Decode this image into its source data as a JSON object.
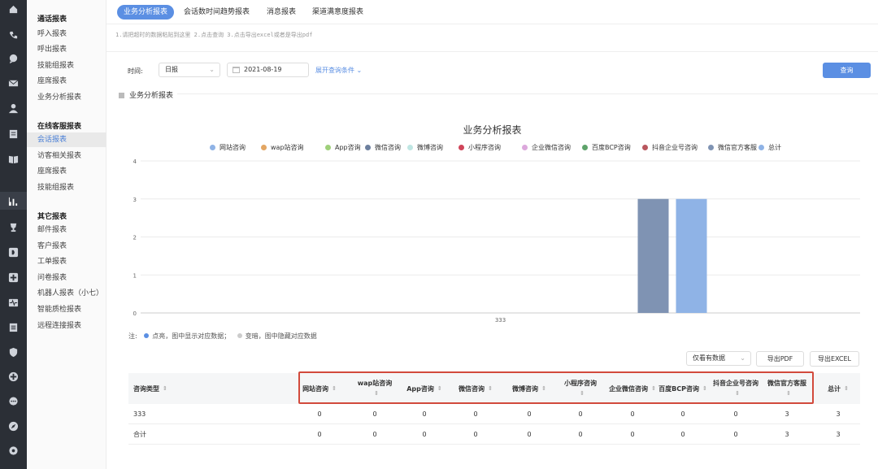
{
  "menu": {
    "groups": [
      {
        "title": "通话报表",
        "items": [
          "呼入报表",
          "呼出报表",
          "技能组报表",
          "座席报表",
          "业务分析报表"
        ]
      },
      {
        "title": "在线客服报表",
        "items": [
          "会话报表",
          "访客相关报表",
          "座席报表",
          "技能组报表"
        ]
      },
      {
        "title": "其它报表",
        "items": [
          "邮件报表",
          "客户报表",
          "工单报表",
          "问卷报表",
          "机器人报表（小七）",
          "智能质检报表",
          "远程连接报表"
        ]
      }
    ],
    "active": "会话报表"
  },
  "rail_icons": [
    "home-icon",
    "phone-icon",
    "chat-icon",
    "mail-icon",
    "user-icon",
    "clipboard-icon",
    "book-icon",
    "report-icon",
    "trophy-icon",
    "d-icon",
    "plus-square-icon",
    "pulse-icon",
    "list-icon",
    "shield-icon",
    "plus-circle-icon",
    "message-icon",
    "compass-icon",
    "settings-icon"
  ],
  "tabs": [
    "业务分析报表",
    "会话数时间趋势报表",
    "消息报表",
    "渠道满意度报表"
  ],
  "hint": "1.请把超时的数据粘贴到这里  2.点击查询  3.点击导出excel或者是导出pdf",
  "filter": {
    "time_label": "时间:",
    "period": "日报",
    "date": "2021-08-19",
    "expand": "展开查询条件",
    "query": "查询"
  },
  "section_title": "业务分析报表",
  "chart_data": {
    "type": "bar",
    "title": "业务分析报表",
    "categories": [
      "333"
    ],
    "ylim": [
      0,
      4
    ],
    "yticks": [
      0,
      1,
      2,
      3,
      4
    ],
    "grid": true,
    "legend_position": "top",
    "series": [
      {
        "name": "网站咨询",
        "color": "#8fb3e6",
        "values": [
          0
        ]
      },
      {
        "name": "wap站咨询",
        "color": "#e3a663",
        "values": [
          0
        ]
      },
      {
        "name": "App咨询",
        "color": "#9fd07a",
        "values": [
          0
        ]
      },
      {
        "name": "微信咨询",
        "color": "#6d7f9e",
        "values": [
          0
        ]
      },
      {
        "name": "微博咨询",
        "color": "#bfe6e3",
        "values": [
          0
        ]
      },
      {
        "name": "小程序咨询",
        "color": "#d0455a",
        "values": [
          0
        ]
      },
      {
        "name": "企业微信咨询",
        "color": "#dca8dc",
        "values": [
          0
        ]
      },
      {
        "name": "百度BCP咨询",
        "color": "#5ea36b",
        "values": [
          0
        ]
      },
      {
        "name": "抖音企业号咨询",
        "color": "#b9575e",
        "values": [
          0
        ]
      },
      {
        "name": "微信官方客服",
        "color": "#7f93b3",
        "values": [
          3
        ]
      },
      {
        "name": "总计",
        "color": "#8fb3e6",
        "values": [
          3
        ]
      }
    ]
  },
  "note": {
    "prefix": "注:",
    "lit": "点亮，图中显示对应数据；",
    "dim": "变暗，图中隐藏对应数据"
  },
  "controls": {
    "only_data": "仅看有数据",
    "export_pdf": "导出PDF",
    "export_excel": "导出EXCEL"
  },
  "table": {
    "headers": [
      "咨询类型",
      "网站咨询",
      "wap站咨询",
      "App咨询",
      "微信咨询",
      "微博咨询",
      "小程序咨询",
      "企业微信咨询",
      "百度BCP咨询",
      "抖音企业号咨询",
      "微信官方客服",
      "总计"
    ],
    "rows": [
      [
        "333",
        "0",
        "0",
        "0",
        "0",
        "0",
        "0",
        "0",
        "0",
        "0",
        "3",
        "3"
      ],
      [
        "合计",
        "0",
        "0",
        "0",
        "0",
        "0",
        "0",
        "0",
        "0",
        "0",
        "3",
        "3"
      ]
    ]
  },
  "colors": {
    "accent": "#5b8fe3",
    "highlight": "#d24a3c",
    "rail_bg": "#2b2f36"
  }
}
